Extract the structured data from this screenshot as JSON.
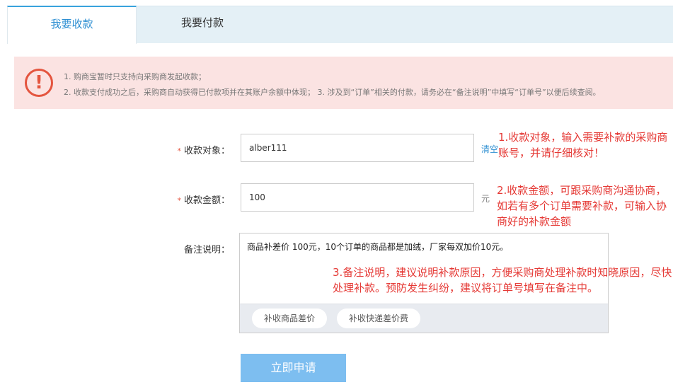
{
  "tabs": [
    {
      "label": "我要收款",
      "active": true
    },
    {
      "label": "我要付款",
      "active": false
    }
  ],
  "notice": {
    "icon": "exclamation-circle-icon",
    "line1": "1. 购商宝暂时只支持向采购商发起收款；",
    "line2": "2. 收款支付成功之后，采购商自动获得已付款项并在其账户余额中体现；  3. 涉及到“订单”相关的付款，请务必在“备注说明”中填写“订单号”以便后续查阅。"
  },
  "form": {
    "required_mark": "*",
    "payee": {
      "label": "收款对象：",
      "value": "alber111",
      "clear_label": "清空"
    },
    "amount": {
      "label": "收款金额：",
      "value": "100",
      "unit": "元"
    },
    "remark": {
      "label": "备注说明：",
      "value": "商品补差价 100元，10个订单的商品都是加绒，厂家每双加价10元。",
      "tags": [
        "补收商品差价",
        "补收快递差价费"
      ]
    },
    "submit_label": "立即申请"
  },
  "annotations": {
    "a1": "1.收款对象，输入需要补款的采购商账号，并请仔细核对！",
    "a2": "2.收款金额，可跟采购商沟通协商，如若有多个订单需要补款，可输入协商好的补款金额",
    "a3": "3.备注说明，建议说明补款原因，方便采购商处理补款时知晓原因，尽快处理补款。预防发生纠纷，建议将订单号填写在备注中。"
  },
  "colors": {
    "accent": "#2e8fd2",
    "warning": "#e4553f",
    "annotation": "#e53935",
    "button": "#7dbef0"
  }
}
